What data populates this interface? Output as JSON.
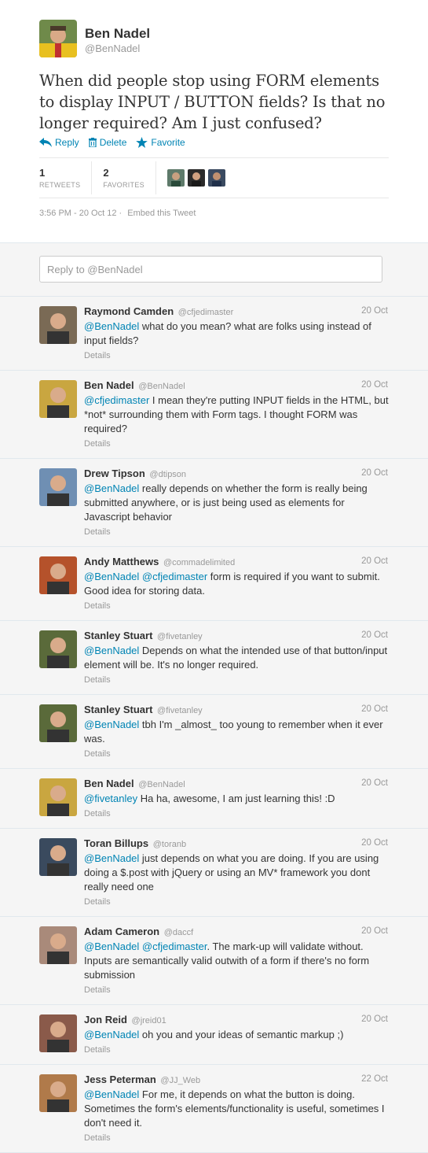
{
  "tweet": {
    "author_name": "Ben Nadel",
    "author_handle": "@BenNadel",
    "text": "When did people stop using FORM elements to display INPUT / BUTTON fields? Is that no longer required? Am I just confused?",
    "actions": {
      "reply": "Reply",
      "delete": "Delete",
      "favorite": "Favorite"
    },
    "retweets": {
      "count": "1",
      "label": "RETWEETS"
    },
    "favorites": {
      "count": "2",
      "label": "FAVORITES"
    },
    "timestamp": "3:56 PM - 20 Oct 12",
    "separator": "·",
    "embed": "Embed this Tweet"
  },
  "reply_box": {
    "placeholder": "Reply to @BenNadel"
  },
  "replies": [
    {
      "name": "Raymond Camden",
      "handle": "@cfjedimaster",
      "date": "20 Oct",
      "mention": "@BenNadel",
      "text": " what do you mean? what are folks using instead of input fields?",
      "details": "Details",
      "avatar": "#7a6a55"
    },
    {
      "name": "Ben Nadel",
      "handle": "@BenNadel",
      "date": "20 Oct",
      "mention": "@cfjedimaster",
      "text": " I mean they're putting INPUT fields in the HTML, but *not* surrounding them with Form tags. I thought FORM was required?",
      "details": "Details",
      "avatar": "#c9a640"
    },
    {
      "name": "Drew Tipson",
      "handle": "@dtipson",
      "date": "20 Oct",
      "mention": "@BenNadel",
      "text": " really depends on whether the form is really being submitted anywhere, or is just being used as elements for Javascript behavior",
      "details": "Details",
      "avatar": "#6f8fb3"
    },
    {
      "name": "Andy Matthews",
      "handle": "@commadelimited",
      "date": "20 Oct",
      "mention": "@BenNadel @cfjedimaster",
      "text": " form is required if you want to submit. Good idea for storing data.",
      "details": "Details",
      "avatar": "#b5522b"
    },
    {
      "name": "Stanley Stuart",
      "handle": "@fivetanley",
      "date": "20 Oct",
      "mention": "@BenNadel",
      "text": " Depends on what the intended use of that button/input element will be. It's no longer required.",
      "details": "Details",
      "avatar": "#5a6a3a"
    },
    {
      "name": "Stanley Stuart",
      "handle": "@fivetanley",
      "date": "20 Oct",
      "mention": "@BenNadel",
      "text": " tbh I'm _almost_ too young to remember when it ever was.",
      "details": "Details",
      "avatar": "#5a6a3a"
    },
    {
      "name": "Ben Nadel",
      "handle": "@BenNadel",
      "date": "20 Oct",
      "mention": "@fivetanley",
      "text": " Ha ha, awesome, I am just learning this! :D",
      "details": "Details",
      "avatar": "#c9a640"
    },
    {
      "name": "Toran Billups",
      "handle": "@toranb",
      "date": "20 Oct",
      "mention": "@BenNadel",
      "text": " just depends on what you are doing. If you are using doing a $.post with jQuery or using an MV* framework you dont really need one",
      "details": "Details",
      "avatar": "#3a4a5e"
    },
    {
      "name": "Adam Cameron",
      "handle": "@daccf",
      "date": "20 Oct",
      "mention": "@BenNadel @cfjedimaster",
      "text": ". The mark-up will validate without. Inputs are semantically valid outwith of a form if there's no form submission",
      "details": "Details",
      "avatar": "#a98a7a"
    },
    {
      "name": "Jon Reid",
      "handle": "@jreid01",
      "date": "20 Oct",
      "mention": "@BenNadel",
      "text": " oh you and your ideas of semantic markup ;)",
      "details": "Details",
      "avatar": "#8a5a4a"
    },
    {
      "name": "Jess Peterman",
      "handle": "@JJ_Web",
      "date": "22 Oct",
      "mention": "@BenNadel",
      "text": " For me, it depends on what the button is doing. Sometimes the form's elements/functionality is useful, sometimes I don't need it.",
      "details": "Details",
      "avatar": "#b07a4a"
    }
  ],
  "colors": {
    "link": "#0084b4",
    "muted": "#999999",
    "text": "#333333",
    "background": "#f5f5f5"
  }
}
